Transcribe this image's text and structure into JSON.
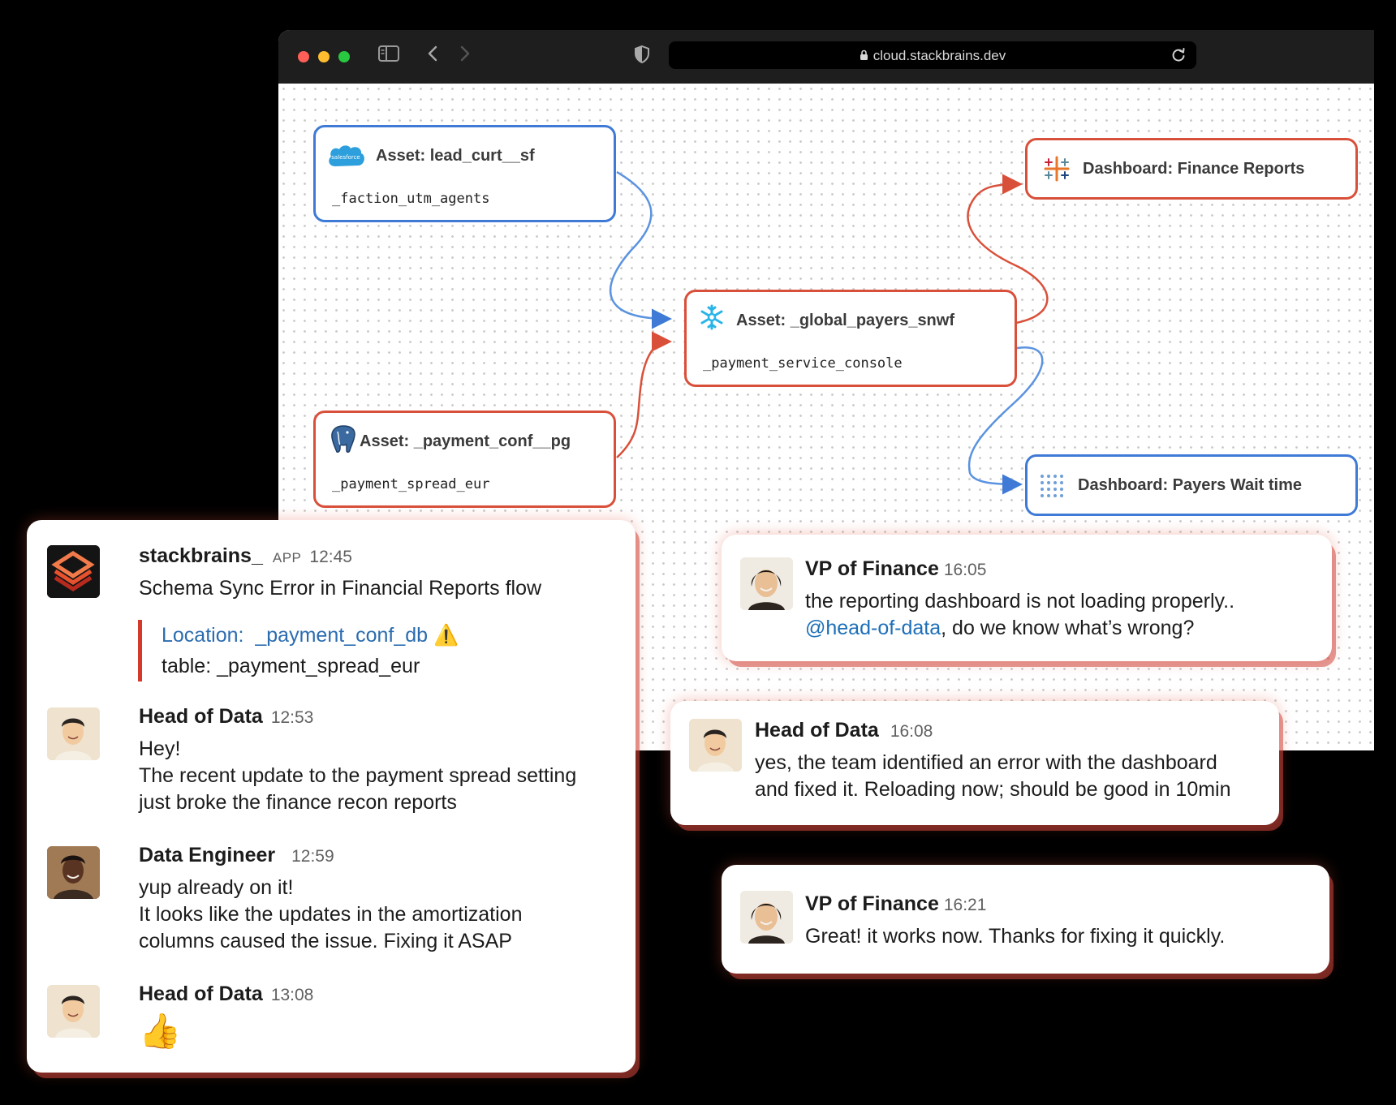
{
  "browser": {
    "url": "cloud.stackbrains.dev"
  },
  "lineage": {
    "nodes": [
      {
        "title": "Asset: lead_curt__sf",
        "subtitle": "_faction_utm_agents",
        "source_icon": "salesforce-icon",
        "source_label": "salesforce"
      },
      {
        "title": "Asset: _payment_conf__pg",
        "subtitle": "_payment_spread_eur",
        "source_icon": "postgres-elephant-icon"
      },
      {
        "title": "Asset: _global_payers_snwf",
        "subtitle": "_payment_service_console",
        "source_icon": "snowflake-icon"
      },
      {
        "title": "Dashboard: Finance Reports",
        "source_icon": "tableau-icon"
      },
      {
        "title": "Dashboard: Payers Wait time",
        "source_icon": "tableau-icon"
      }
    ],
    "colors": {
      "ok": "#3e7ad6",
      "error": "#d9503a"
    }
  },
  "chat_main": {
    "alert": {
      "sender": "stackbrains_",
      "tag": "APP",
      "time": "12:45",
      "text": "Schema Sync Error in Financial Reports flow",
      "location_label": "Location:",
      "location_value": "_payment_conf_db",
      "table_line": "table: _payment_spread_eur"
    },
    "messages": [
      {
        "sender": "Head of Data",
        "time": "12:53",
        "lines": [
          "Hey!",
          "The recent update to the payment spread setting",
          "just broke the finance recon reports"
        ]
      },
      {
        "sender": "Data Engineer",
        "time": "12:59",
        "lines": [
          "yup already on it!",
          "It looks like the updates in the amortization",
          "columns caused the issue. Fixing it ASAP"
        ]
      },
      {
        "sender": "Head of Data",
        "time": "13:08",
        "emoji": "👍"
      }
    ]
  },
  "chat_side": [
    {
      "sender": "VP of Finance",
      "time": "16:05",
      "line1": "the reporting dashboard is not loading properly..",
      "mention": "@head-of-data",
      "line2_rest": ", do we know what’s wrong?"
    },
    {
      "sender": "Head of Data",
      "time": "16:08",
      "line1": "yes, the team identified an error with the dashboard",
      "line2": "and fixed it. Reloading now; should be good in 10min"
    },
    {
      "sender": "VP of Finance",
      "time": "16:21",
      "line1": "Great! it works now. Thanks for fixing it quickly."
    }
  ]
}
